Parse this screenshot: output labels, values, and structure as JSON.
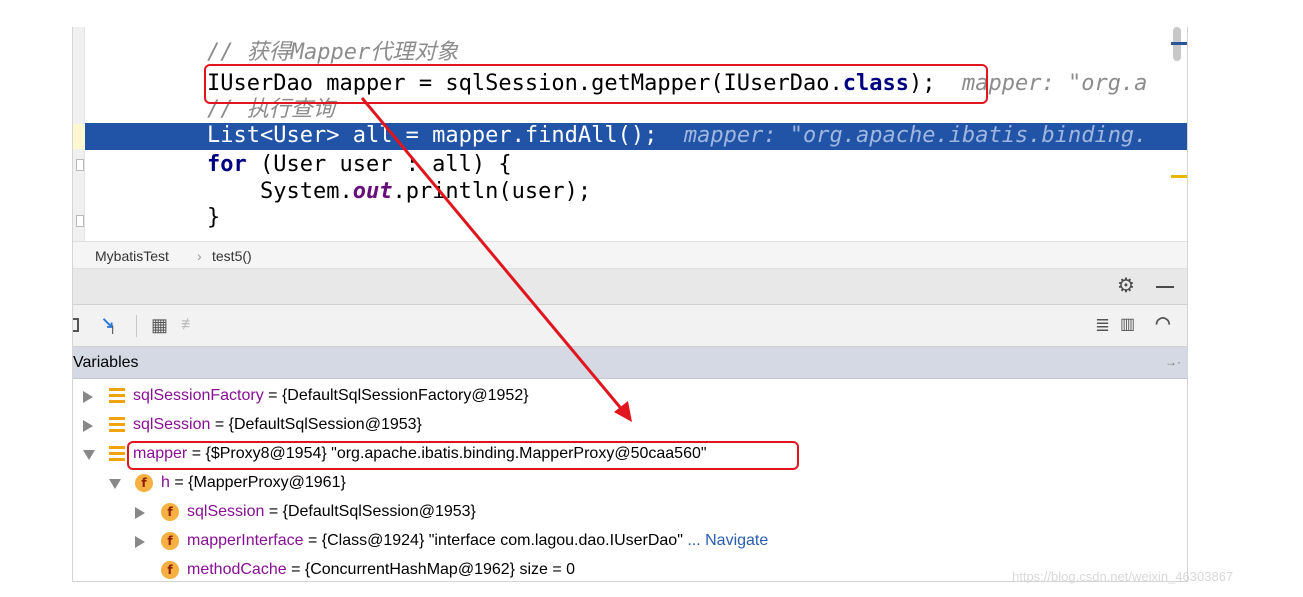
{
  "editor": {
    "lines": {
      "comment1": "// 获得Mapper代理对象",
      "line2_code": "IUserDao mapper = sqlSession.getMapper(IUserDao.",
      "line2_kw": "class",
      "line2_tail": ");",
      "line2_hint": "mapper: \"org.a",
      "comment2": "// 执行查询",
      "line4_code": "List<User> all = mapper.findAll();",
      "line4_hint": "mapper: \"org.apache.ibatis.binding.",
      "line5_kw": "for",
      "line5_code": " (User user : all) {",
      "line6_pre": "    System.",
      "line6_static": "out",
      "line6_post": ".println(user);",
      "line7": "}"
    }
  },
  "breadcrumb": {
    "class": "MybatisTest",
    "separator": "›",
    "method": "test5()"
  },
  "panel": {
    "variables_title": "Variables"
  },
  "variables": [
    {
      "name": "sqlSessionFactory",
      "value": " = {DefaultSqlSessionFactory@1952}"
    },
    {
      "name": "sqlSession",
      "value": " = {DefaultSqlSession@1953}"
    },
    {
      "name": "mapper",
      "value": " = {$Proxy8@1954} \"org.apache.ibatis.binding.MapperProxy@50caa560\""
    },
    {
      "name": "h",
      "value": " = {MapperProxy@1961}",
      "icon": "f"
    },
    {
      "name": "sqlSession",
      "value": " = {DefaultSqlSession@1953}",
      "icon": "f"
    },
    {
      "name": "mapperInterface",
      "value": " = {Class@1924} \"interface com.lagou.dao.IUserDao\"",
      "icon": "f",
      "link": "... Navigate"
    },
    {
      "name": "methodCache",
      "value": " = {ConcurrentHashMap@1962}  size = 0",
      "icon": "f"
    }
  ],
  "watermark": "https://blog.csdn.net/weixin_46303867",
  "colors": {
    "exec_line": "#2154a7",
    "annotation": "#e0151e",
    "var_name": "#871094"
  }
}
